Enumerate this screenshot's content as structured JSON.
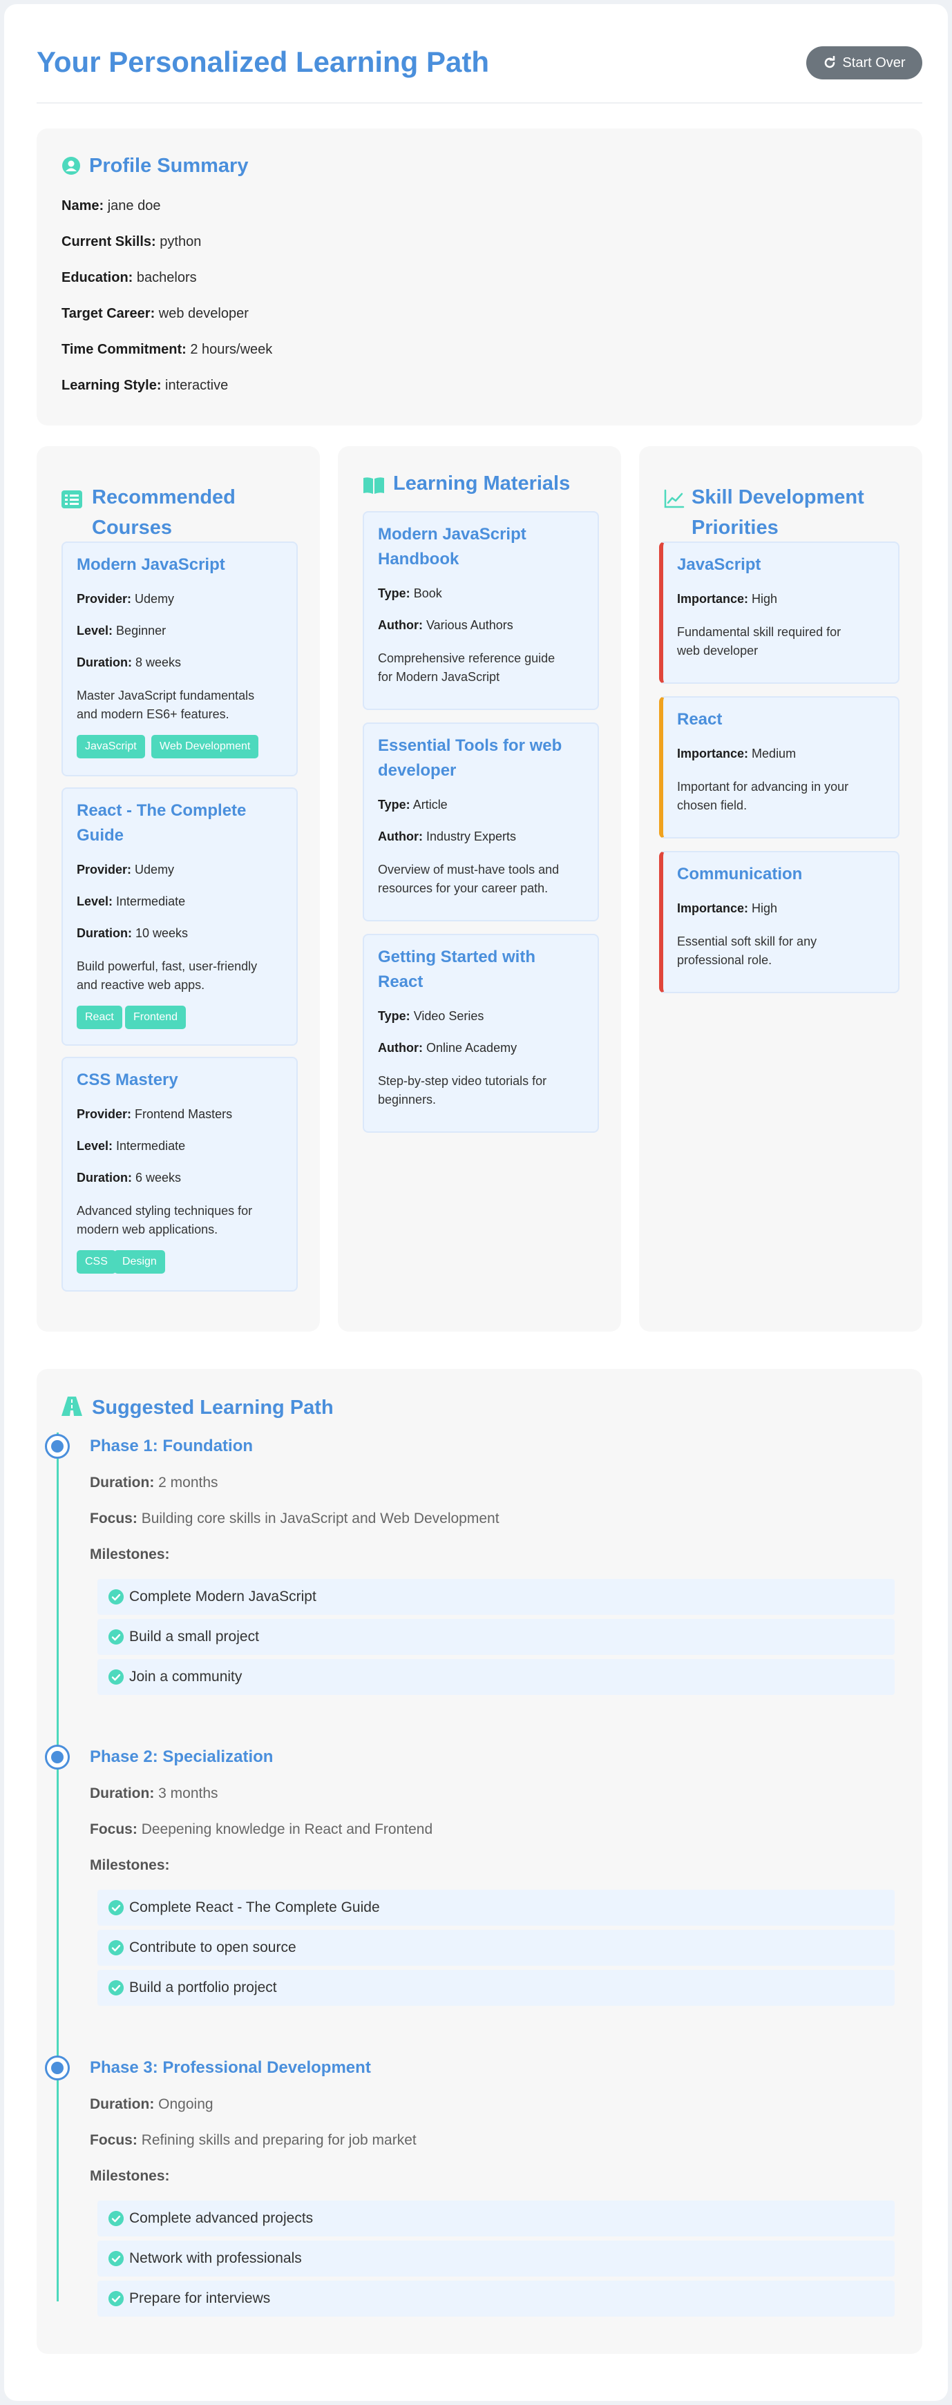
{
  "header": {
    "title": "Your Personalized Learning Path",
    "start_over_label": "Start Over"
  },
  "profile": {
    "title": "Profile Summary",
    "fields": [
      {
        "label": "Name:",
        "value": "jane doe"
      },
      {
        "label": "Current Skills:",
        "value": "python"
      },
      {
        "label": "Education:",
        "value": "bachelors"
      },
      {
        "label": "Target Career:",
        "value": "web developer"
      },
      {
        "label": "Time Commitment:",
        "value": "2 hours/week"
      },
      {
        "label": "Learning Style:",
        "value": "interactive"
      }
    ]
  },
  "courses": {
    "title_line1": "Recommended",
    "title_line2": "Courses",
    "items": [
      {
        "title": "Modern JavaScript",
        "provider": "Udemy",
        "level": "Beginner",
        "duration": "8 weeks",
        "desc1": "Master JavaScript fundamentals",
        "desc2": "and modern ES6+ features.",
        "tags": [
          "JavaScript",
          "Web Development"
        ]
      },
      {
        "title_line1": "React - The Complete",
        "title_line2": "Guide",
        "provider": "Udemy",
        "level": "Intermediate",
        "duration": "10 weeks",
        "desc1": "Build powerful, fast, user-friendly",
        "desc2": "and reactive web apps.",
        "tags": [
          "React",
          "Frontend"
        ]
      },
      {
        "title": "CSS Mastery",
        "provider": "Frontend Masters",
        "level": "Intermediate",
        "duration": "6 weeks",
        "desc1": "Advanced styling techniques for",
        "desc2": "modern web applications.",
        "tags": [
          "CSS",
          "Design"
        ]
      }
    ],
    "labels": {
      "provider": "Provider:",
      "level": "Level:",
      "duration": "Duration:"
    }
  },
  "materials": {
    "title": "Learning Materials",
    "labels": {
      "type": "Type:",
      "author": "Author:"
    },
    "items": [
      {
        "title_line1": "Modern JavaScript",
        "title_line2": "Handbook",
        "type": "Book",
        "author": "Various Authors",
        "desc1": "Comprehensive reference guide",
        "desc2": "for Modern JavaScript"
      },
      {
        "title_line1": "Essential Tools for web",
        "title_line2": "developer",
        "type": "Article",
        "author": "Industry Experts",
        "desc1": "Overview of must-have tools and",
        "desc2": "resources for your career path."
      },
      {
        "title_line1": "Getting Started with",
        "title_line2": "React",
        "type": "Video Series",
        "author": "Online Academy",
        "desc1": "Step-by-step video tutorials for",
        "desc2": "beginners."
      }
    ]
  },
  "skills": {
    "title_line1": "Skill Development",
    "title_line2": "Priorities",
    "importance_label": "Importance:",
    "items": [
      {
        "title": "JavaScript",
        "importance": "High",
        "desc1": "Fundamental skill required for",
        "desc2": "web developer"
      },
      {
        "title": "React",
        "importance": "Medium",
        "desc1": "Important for advancing in your",
        "desc2": "chosen field."
      },
      {
        "title": "Communication",
        "importance": "High",
        "desc1": "Essential soft skill for any",
        "desc2": "professional role."
      }
    ],
    "colors": {
      "high": "#e0463b",
      "medium": "#f0a21e"
    }
  },
  "path": {
    "title": "Suggested Learning Path",
    "labels": {
      "duration": "Duration:",
      "focus": "Focus:",
      "milestones": "Milestones:"
    },
    "phases": [
      {
        "title": "Phase 1: Foundation",
        "duration": "2 months",
        "focus": "Building core skills in JavaScript and Web Development",
        "milestones": [
          "Complete Modern JavaScript",
          "Build a small project",
          "Join a community"
        ]
      },
      {
        "title": "Phase 2: Specialization",
        "duration": "3 months",
        "focus": "Deepening knowledge in React and Frontend",
        "milestones": [
          "Complete React - The Complete Guide",
          "Contribute to open source",
          "Build a portfolio project"
        ]
      },
      {
        "title": "Phase 3: Professional Development",
        "duration": "Ongoing",
        "focus": "Refining skills and preparing for job market",
        "milestones": [
          "Complete advanced projects",
          "Network with professionals",
          "Prepare for interviews"
        ]
      }
    ]
  },
  "theme": {
    "accent": "#4a8fdc",
    "teal": "#4dd9bd",
    "button_gray": "#6c757d"
  }
}
